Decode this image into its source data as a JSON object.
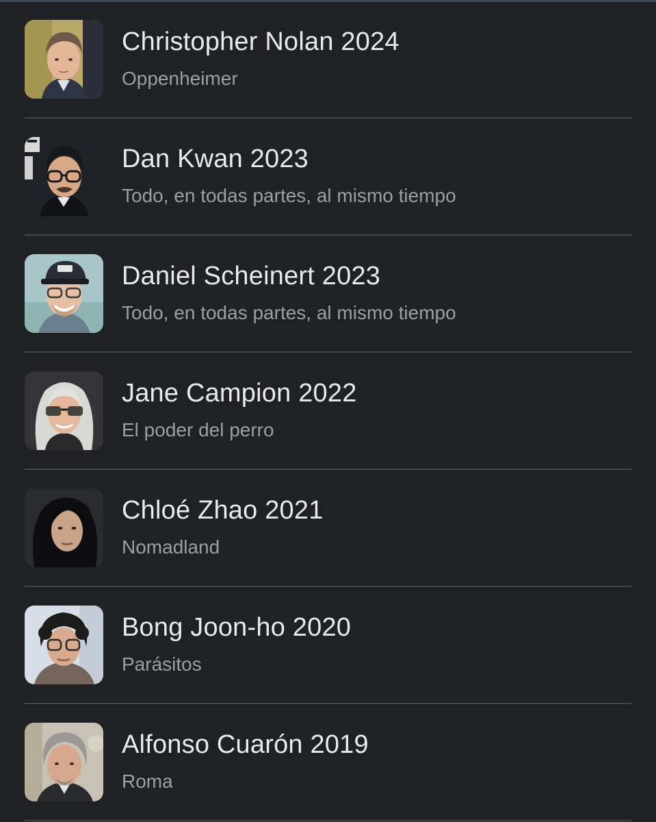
{
  "directors": [
    {
      "title": "Christopher Nolan 2024",
      "film": "Oppenheimer"
    },
    {
      "title": "Dan Kwan 2023",
      "film": "Todo, en todas partes, al mismo tiempo"
    },
    {
      "title": "Daniel Scheinert 2023",
      "film": "Todo, en todas partes, al mismo tiempo"
    },
    {
      "title": "Jane Campion 2022",
      "film": "El poder del perro"
    },
    {
      "title": "Chloé Zhao 2021",
      "film": "Nomadland"
    },
    {
      "title": "Bong Joon-ho 2020",
      "film": "Parásitos"
    },
    {
      "title": "Alfonso Cuarón 2019",
      "film": "Roma"
    }
  ]
}
